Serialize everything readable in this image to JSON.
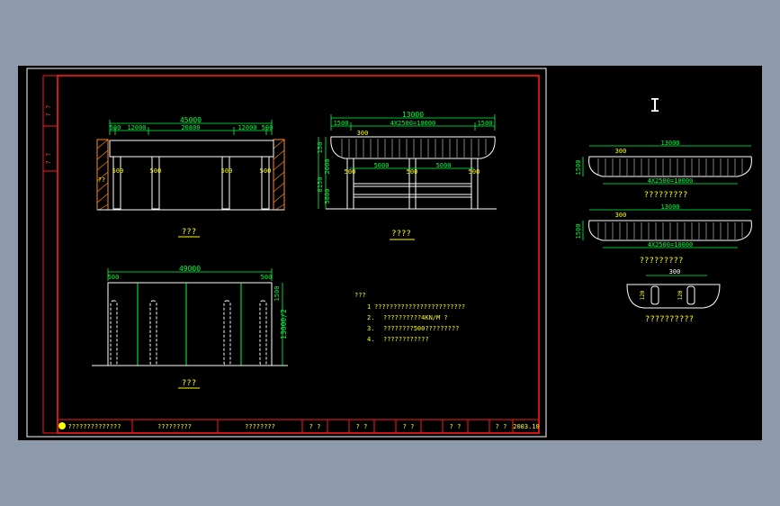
{
  "colors": {
    "background": "#8d9aab",
    "canvas": "#000000",
    "frame": "#ff1a1a",
    "dimension": "#00ff40",
    "outline": "#ffffff",
    "label_yellow": "#ffff00",
    "note_text": "#ffff00"
  },
  "side_strip": {
    "label_top": "? ?",
    "label_bottom": "? ?"
  },
  "elevation_front": {
    "title": "???",
    "dim_total": "45000",
    "dim_parts": [
      "500",
      "12000",
      "20800",
      "12000",
      "500"
    ],
    "column_labels": [
      "500",
      "500",
      "500",
      "500"
    ],
    "wall_label": "??"
  },
  "elevation_side": {
    "title": "????",
    "dim_total": "13000",
    "dim_parts": [
      "1500",
      "4X2500=10000",
      "1500"
    ],
    "dim_lower": [
      "5000",
      "5000"
    ],
    "vertical_dims": [
      "150",
      "2000",
      "8150",
      "5800"
    ],
    "top_label": "300",
    "column_labels": [
      "500",
      "500",
      "500"
    ]
  },
  "plan": {
    "title": "???",
    "dim_total": "49000",
    "dim_parts": [
      "500",
      "500"
    ],
    "vertical_dims": [
      "1500",
      "13000/2"
    ]
  },
  "notes": {
    "heading": "???",
    "items": [
      {
        "num": "1",
        "text": "????????????????????????"
      },
      {
        "num": "2.",
        "text": "??????????4KN/M ?"
      },
      {
        "num": "3.",
        "text": "????????500?????????"
      },
      {
        "num": "4.",
        "text": "????????????"
      }
    ]
  },
  "right_panel": {
    "marker": "I",
    "section1": {
      "dim_total": "13000",
      "dim_mid": "4X2500=10000",
      "left_dim": "1500",
      "top_dim": "300",
      "caption": "?????????"
    },
    "section2": {
      "dim_total": "13000",
      "dim_mid": "4X2500=10000",
      "left_dim": "1500",
      "top_dim": "300",
      "caption": "?????????"
    },
    "section3": {
      "top_dim": "300",
      "left_dim": "120",
      "right_dim": "120",
      "caption": "??????????"
    }
  },
  "title_block": {
    "cells": [
      "??????????????",
      "?????????",
      "????????",
      "? ?",
      "? ?",
      "? ?",
      "? ?",
      "? ?"
    ],
    "date": "2003.10"
  }
}
